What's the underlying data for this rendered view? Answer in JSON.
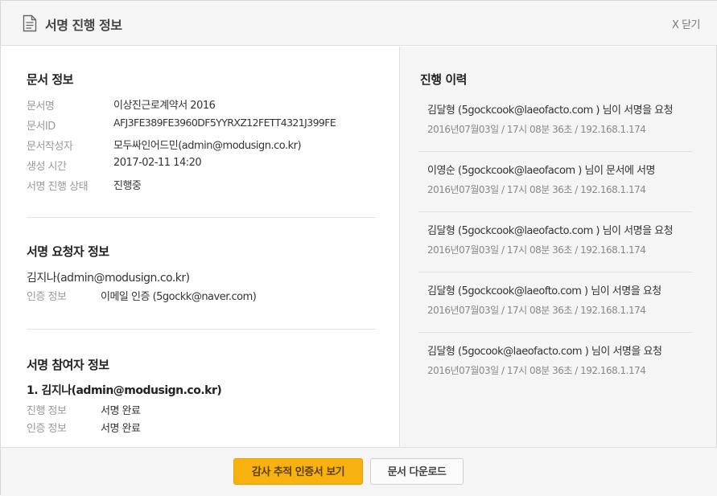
{
  "header": {
    "title": "서명 진행 정보",
    "close_label": "X 닫기",
    "icon": "document-icon"
  },
  "document_info": {
    "title": "문서 정보",
    "rows": [
      {
        "label": "문서명",
        "value": "이상진근로계약서 2016"
      },
      {
        "label": "문서ID",
        "value": "AFJ3FE389FE3960DF5YYRXZ12FETT4321J399FE"
      },
      {
        "label": "문서작성자",
        "value": "모두싸인어드민(admin@modusign.co.kr)"
      },
      {
        "label": "생성 시간",
        "value": "2017-02-11 14:20"
      },
      {
        "label": "서명 진행 상태",
        "value": "진행중"
      }
    ]
  },
  "requester_info": {
    "title": "서명 요청자 정보",
    "name": "김지나(admin@modusign.co.kr)",
    "auth_label": "인증 정보",
    "auth_value": "이메일 인증 (5gockk@naver.com)"
  },
  "participant_info": {
    "title": "서명 참여자 정보",
    "participant": "1. 김지나(admin@modusign.co.kr)",
    "rows": [
      {
        "label": "진행 정보",
        "value": "서명 완료"
      },
      {
        "label": "인증 정보",
        "value": "서명 완료"
      }
    ]
  },
  "history": {
    "title": "진행 이력",
    "items": [
      {
        "text": "김달형 (5gockcook@laeofacto.com ) 님이 서명을 요청",
        "meta": "2016년07월03일 / 17시 08분 36초 / 192.168.1.174"
      },
      {
        "text": "이영순 (5gockcook@laeofacom ) 님이 문서에 서명",
        "meta": "2016년07월03일 / 17시 08분 36초 / 192.168.1.174"
      },
      {
        "text": "김달형 (5gockcook@laeofacto.com ) 님이 서명을 요청",
        "meta": "2016년07월03일 / 17시 08분 36초 / 192.168.1.174"
      },
      {
        "text": "김달형 (5gockcook@laeofto.com ) 님이 서명을 요청",
        "meta": "2016년07월03일 / 17시 08분 36초 / 192.168.1.174"
      },
      {
        "text": "김달형 (5gocook@laeofacto.com ) 님이 서명을 요청",
        "meta": "2016년07월03일 / 17시 08분 36초 / 192.168.1.174"
      }
    ]
  },
  "footer": {
    "audit_button": "감사 추적 인증서 보기",
    "download_button": "문서 다운로드"
  },
  "colors": {
    "accent": "#f7b20f",
    "panel_bg": "#f5f5f5",
    "divider": "#e0e0e0"
  }
}
